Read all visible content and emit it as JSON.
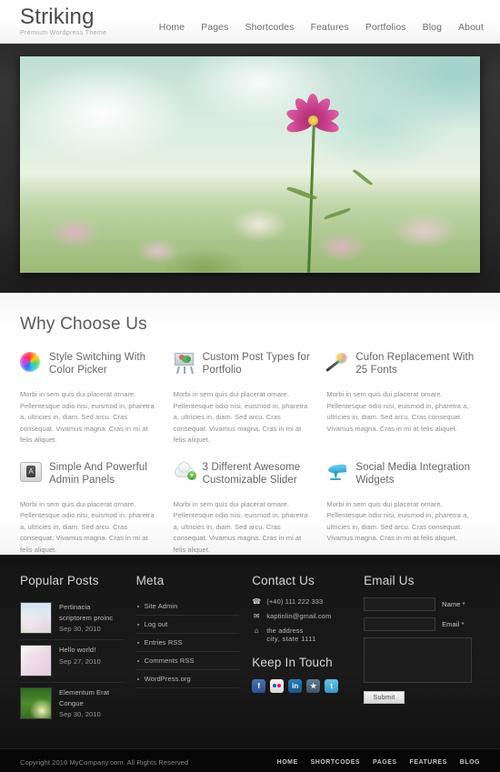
{
  "header": {
    "logo_title": "Striking",
    "logo_subtitle": "Premium Wordpress Theme",
    "nav": [
      {
        "label": "Home"
      },
      {
        "label": "Pages"
      },
      {
        "label": "Shortcodes"
      },
      {
        "label": "Features"
      },
      {
        "label": "Portfolios"
      },
      {
        "label": "Blog"
      },
      {
        "label": "About"
      }
    ]
  },
  "hero": {
    "alt": "pink cosmos flower against bright cloudy sky"
  },
  "features": {
    "title": "Why Choose Us",
    "body_text": "Morbi in sem quis dui placerat ornare. Pellentesque odio nisi, euismod in, pharetra a, ultricies in, diam. Sed arcu. Cras consequat. Vivamus magna. Cras in mi at felis aliquet.",
    "items": [
      {
        "title": "Style Switching With Color Picker",
        "icon": "color-wheel-icon"
      },
      {
        "title": "Custom Post Types for Portfolio",
        "icon": "easel-icon"
      },
      {
        "title": "Cufon Replacement With 25 Fonts",
        "icon": "magic-wand-icon"
      },
      {
        "title": "Simple And Powerful Admin Panels",
        "icon": "admin-panel-icon"
      },
      {
        "title": "3 Different Awesome Customizable Slider",
        "icon": "cloud-download-icon"
      },
      {
        "title": "Social Media Integration Widgets",
        "icon": "twitter-bird-icon"
      }
    ]
  },
  "footer": {
    "popular_posts": {
      "title": "Popular Posts",
      "items": [
        {
          "title": "Pertinacia scriptorem proinc",
          "date": "Sep 30, 2010"
        },
        {
          "title": "Hello world!",
          "date": "Sep 27, 2010"
        },
        {
          "title": "Elementum Erat Congue",
          "date": "Sep 30, 2010"
        }
      ]
    },
    "meta": {
      "title": "Meta",
      "items": [
        {
          "label": "Site Admin"
        },
        {
          "label": "Log out"
        },
        {
          "label": "Entries RSS"
        },
        {
          "label": "Comments RSS"
        },
        {
          "label": "WordPress.org"
        }
      ]
    },
    "contact": {
      "title": "Contact Us",
      "phone": "(+40) 111 222 333",
      "email": "kaptinlin@gmail.com",
      "address_line1": "the address",
      "address_line2": "city, state  1111",
      "keep_in_touch_title": "Keep In Touch",
      "social": [
        {
          "name": "facebook",
          "glyph": "f"
        },
        {
          "name": "flickr",
          "glyph": ""
        },
        {
          "name": "linkedin",
          "glyph": "in"
        },
        {
          "name": "myspace",
          "glyph": ""
        },
        {
          "name": "twitter",
          "glyph": "t"
        }
      ]
    },
    "email_form": {
      "title": "Email Us",
      "name_label": "Name *",
      "email_label": "Email *",
      "name_value": "",
      "email_value": "",
      "message_value": "",
      "submit_label": "Submit"
    }
  },
  "bottom": {
    "copyright": "Copyright  2010 MyCompany.com. All Rights Reserved",
    "nav": [
      {
        "label": "HOME"
      },
      {
        "label": "SHORTCODES"
      },
      {
        "label": "PAGES"
      },
      {
        "label": "FEATURES"
      },
      {
        "label": "BLOG"
      }
    ]
  },
  "colors": {
    "accent_pink": "#c13c86",
    "header_bg": "#ffffff",
    "footer_bg": "#1a1a1a",
    "bottom_bg": "#060606"
  }
}
